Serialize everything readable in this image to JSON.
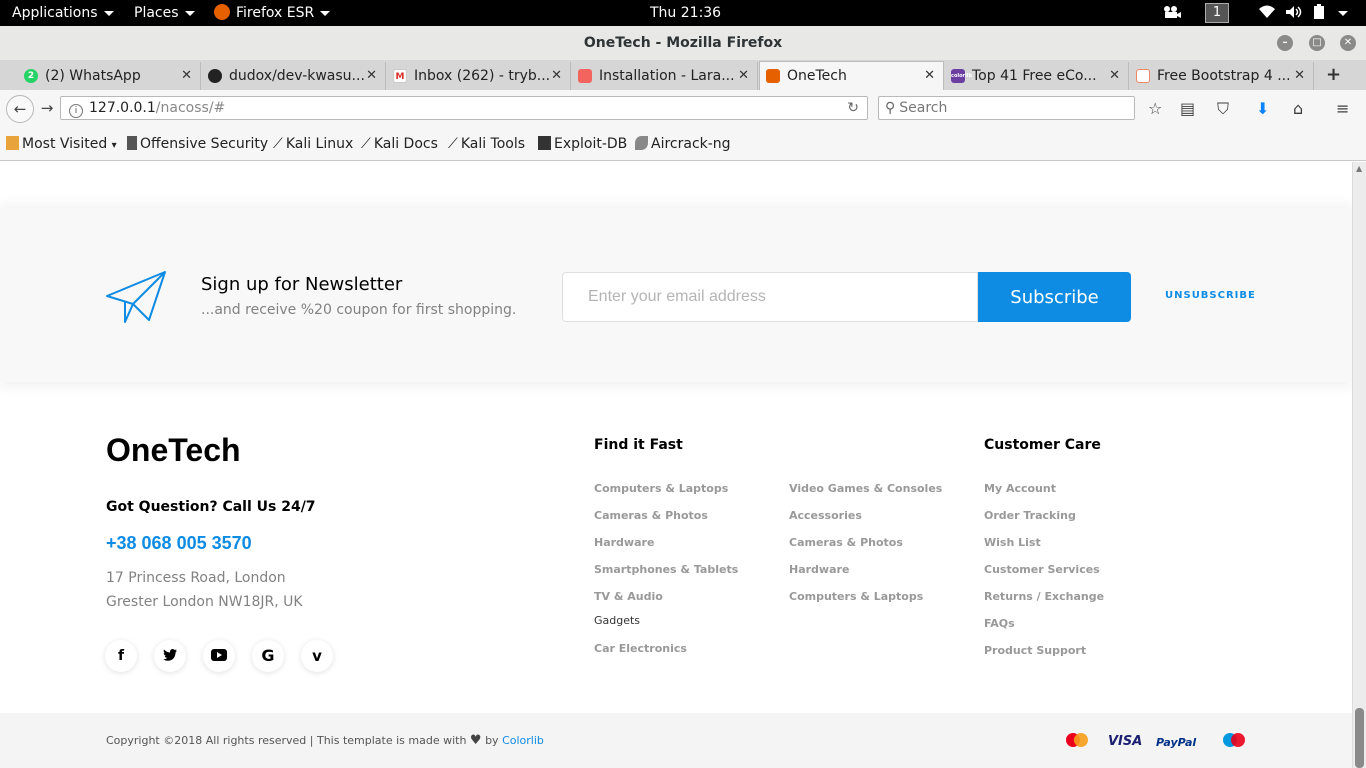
{
  "system": {
    "applications": "Applications",
    "places": "Places",
    "app_name": "Firefox ESR",
    "clock": "Thu 21:36",
    "workspace": "1"
  },
  "window": {
    "title": "OneTech - Mozilla Firefox"
  },
  "tabs": [
    {
      "label": "(2) WhatsApp",
      "icon": "whatsapp-icon",
      "badge": "2"
    },
    {
      "label": "dudox/dev-kwasu...",
      "icon": "github-icon"
    },
    {
      "label": "Inbox (262) - tryb...",
      "icon": "gmail-icon"
    },
    {
      "label": "Installation - Lara...",
      "icon": "laravel-icon"
    },
    {
      "label": "OneTech",
      "icon": "onetech-icon",
      "active": true
    },
    {
      "label": "Top 41 Free eCo...",
      "icon": "colorlib-icon"
    },
    {
      "label": "Free Bootstrap 4 ...",
      "icon": "bootstrap-icon"
    }
  ],
  "navbar": {
    "url_host": "127.0.0.1",
    "url_path": "/nacoss/#",
    "search_placeholder": "Search"
  },
  "bookmarks": [
    {
      "label": "Most Visited"
    },
    {
      "label": "Offensive Security"
    },
    {
      "label": "Kali Linux"
    },
    {
      "label": "Kali Docs"
    },
    {
      "label": "Kali Tools"
    },
    {
      "label": "Exploit-DB"
    },
    {
      "label": "Aircrack-ng"
    }
  ],
  "newsletter": {
    "title": "Sign up for Newsletter",
    "subtitle": "...and receive %20 coupon for first shopping.",
    "email_placeholder": "Enter your email address",
    "subscribe": "Subscribe",
    "unsubscribe": "UNSUBSCRIBE"
  },
  "footer": {
    "logo": "OneTech",
    "question": "Got Question? Call Us 24/7",
    "phone": "+38 068 005 3570",
    "address_line1": "17 Princess Road, London",
    "address_line2": "Grester London NW18JR, UK",
    "social": [
      "facebook-icon",
      "twitter-icon",
      "youtube-icon",
      "google-icon",
      "vimeo-icon"
    ],
    "find_heading": "Find it Fast",
    "find_col1": [
      "Computers & Laptops",
      "Cameras & Photos",
      "Hardware",
      "Smartphones & Tablets",
      "TV & Audio",
      "Gadgets",
      "Car Electronics"
    ],
    "find_col2": [
      "Video Games & Consoles",
      "Accessories",
      "Cameras & Photos",
      "Hardware",
      "Computers & Laptops"
    ],
    "care_heading": "Customer Care",
    "care_links": [
      "My Account",
      "Order Tracking",
      "Wish List",
      "Customer Services",
      "Returns / Exchange",
      "FAQs",
      "Product Support"
    ]
  },
  "copyright": {
    "text_before": "Copyright ©2018 All rights reserved | This template is made with",
    "by": "by",
    "link": "Colorlib"
  },
  "payments": [
    "mastercard",
    "VISA",
    "PayPal",
    "maestro"
  ]
}
